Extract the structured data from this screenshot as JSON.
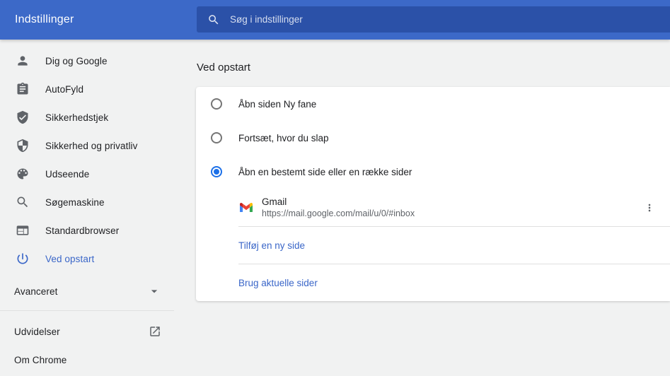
{
  "colors": {
    "header_bg": "#3c69c8",
    "search_bg": "#2b51a8",
    "accent": "#3a66c8",
    "radio_selected": "#1c70e8",
    "text": "#202124",
    "secondary": "#5f6368",
    "icon": "#5f6368",
    "page_bg": "#f1f2f2",
    "card_bg": "#ffffff",
    "divider": "#e0e0e0"
  },
  "header": {
    "title": "Indstillinger",
    "search_placeholder": "Søg i indstillinger"
  },
  "sidebar": {
    "items": [
      {
        "label": "Dig og Google",
        "icon": "person-icon",
        "active": false
      },
      {
        "label": "AutoFyld",
        "icon": "autofill-icon",
        "active": false
      },
      {
        "label": "Sikkerhedstjek",
        "icon": "safety-check-icon",
        "active": false
      },
      {
        "label": "Sikkerhed og privatliv",
        "icon": "security-shield-icon",
        "active": false
      },
      {
        "label": "Udseende",
        "icon": "palette-icon",
        "active": false
      },
      {
        "label": "Søgemaskine",
        "icon": "search-icon",
        "active": false
      },
      {
        "label": "Standardbrowser",
        "icon": "browser-icon",
        "active": false
      },
      {
        "label": "Ved opstart",
        "icon": "power-icon",
        "active": true
      }
    ],
    "advanced_label": "Avanceret",
    "extensions_label": "Udvidelser",
    "about_label": "Om Chrome"
  },
  "main": {
    "section_title": "Ved opstart",
    "options": [
      {
        "label": "Åbn siden Ny fane",
        "selected": false
      },
      {
        "label": "Fortsæt, hvor du slap",
        "selected": false
      },
      {
        "label": "Åbn en bestemt side eller en række sider",
        "selected": true
      }
    ],
    "startup_page": {
      "title": "Gmail",
      "url": "https://mail.google.com/mail/u/0/#inbox",
      "icon": "gmail-icon"
    },
    "add_page_label": "Tilføj en ny side",
    "use_current_label": "Brug aktuelle sider"
  }
}
